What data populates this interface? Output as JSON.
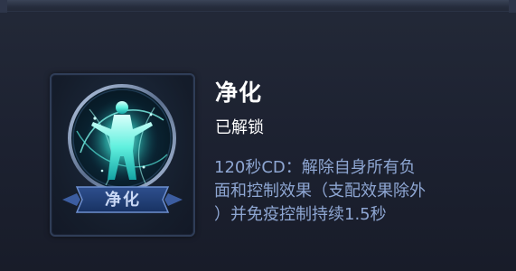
{
  "skill": {
    "name": "净化",
    "badge_label": "净化",
    "status": "已解锁",
    "description_lines": [
      "120秒CD：解除自身所有负",
      "面和控制效果（支配效果除外",
      "）并免疫控制持续1.5秒"
    ],
    "icon": "purify-figure-icon"
  },
  "colors": {
    "background": "#1d2231",
    "title": "#ffffff",
    "description": "#8ea6d2",
    "icon_glow": "#3ee6d8",
    "frame_border": "#2f3d57"
  }
}
